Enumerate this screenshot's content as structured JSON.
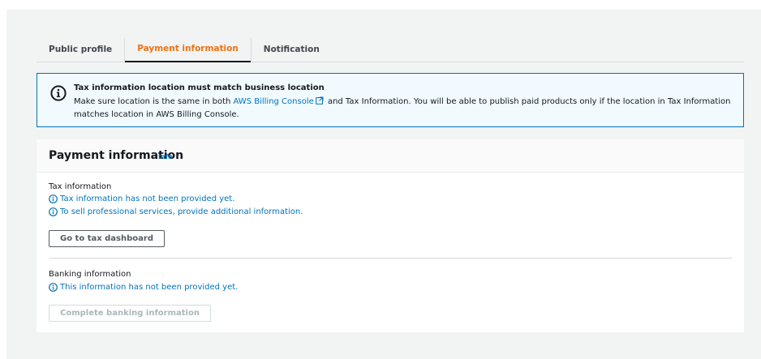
{
  "tabs": [
    {
      "label": "Public profile",
      "active": false
    },
    {
      "label": "Payment information",
      "active": true
    },
    {
      "label": "Notification",
      "active": false
    }
  ],
  "alert": {
    "icon": "info-icon",
    "title": "Tax information location must match business location",
    "body_before_link": "Make sure location is the same in both ",
    "link_text": "AWS Billing Console",
    "body_after_link": " and Tax Information. You will be able to publish paid products only if the location in Tax Information matches location in AWS Billing Console."
  },
  "panel": {
    "title": "Payment information",
    "info_label": "Info",
    "tax": {
      "label": "Tax information",
      "messages": [
        "Tax information has not been provided yet.",
        "To sell professional services, provide additional information."
      ],
      "button_label": "Go to tax dashboard"
    },
    "banking": {
      "label": "Banking information",
      "message": "This information has not been provided yet.",
      "button_label": "Complete banking information",
      "button_disabled": true
    }
  },
  "colors": {
    "accent_orange": "#ec7211",
    "link_blue": "#0073bb",
    "alert_bg": "#f1faff",
    "page_bg": "#f2f3f3"
  }
}
